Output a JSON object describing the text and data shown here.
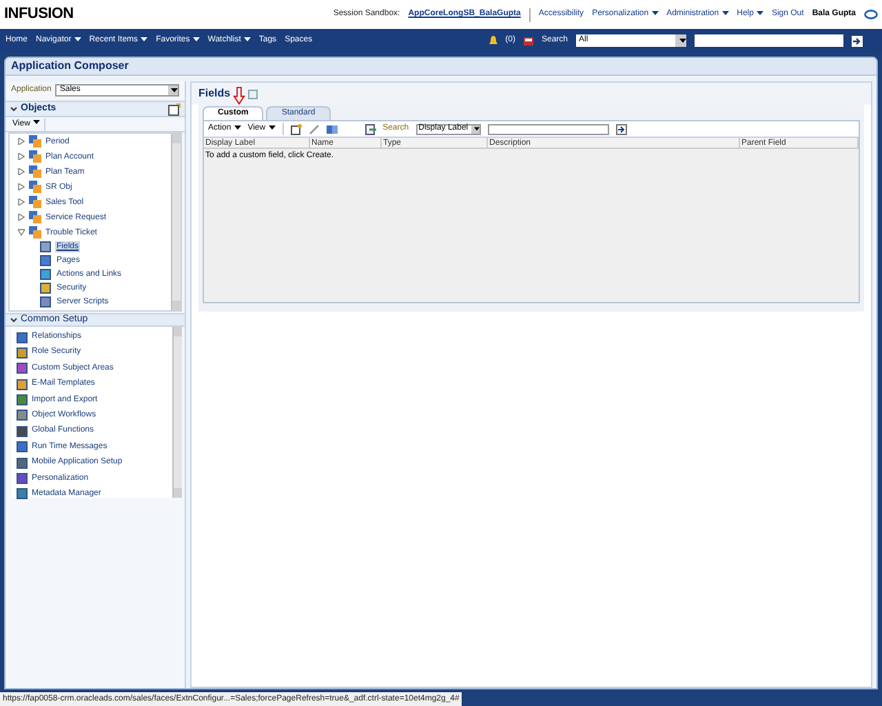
{
  "header": {
    "logo": "INFUSION",
    "session_label": "Session Sandbox:",
    "session_link": "AppCoreLongSB_BalaGupta",
    "links": [
      {
        "label": "Accessibility",
        "dropdown": false
      },
      {
        "label": "Personalization",
        "dropdown": true
      },
      {
        "label": "Administration",
        "dropdown": true
      },
      {
        "label": "Help",
        "dropdown": true
      },
      {
        "label": "Sign Out",
        "dropdown": false
      }
    ],
    "user": "Bala Gupta"
  },
  "nav": {
    "items": [
      {
        "label": "Home",
        "dropdown": false
      },
      {
        "label": "Navigator",
        "dropdown": true
      },
      {
        "label": "Recent Items",
        "dropdown": true
      },
      {
        "label": "Favorites",
        "dropdown": true
      },
      {
        "label": "Watchlist",
        "dropdown": true
      },
      {
        "label": "Tags",
        "dropdown": false
      },
      {
        "label": "Spaces",
        "dropdown": false
      }
    ],
    "notifications": "(0)",
    "search_label": "Search",
    "search_scope": "All"
  },
  "page_title": "Application Composer",
  "sidebar": {
    "application_label": "Application",
    "application_value": "Sales",
    "objects": {
      "title": "Objects",
      "view_menu": "View",
      "items": [
        {
          "label": "Period",
          "expanded": false
        },
        {
          "label": "Plan Account",
          "expanded": false
        },
        {
          "label": "Plan Team",
          "expanded": false
        },
        {
          "label": "SR Obj",
          "expanded": false
        },
        {
          "label": "Sales Tool",
          "expanded": false
        },
        {
          "label": "Service Request",
          "expanded": false
        },
        {
          "label": "Trouble Ticket",
          "expanded": true,
          "children": [
            {
              "label": "Fields",
              "selected": true
            },
            {
              "label": "Pages",
              "selected": false
            },
            {
              "label": "Actions and Links",
              "selected": false
            },
            {
              "label": "Security",
              "selected": false
            },
            {
              "label": "Server Scripts",
              "selected": false
            }
          ]
        }
      ]
    },
    "common_setup": {
      "title": "Common Setup",
      "items": [
        "Relationships",
        "Role Security",
        "Custom Subject Areas",
        "E-Mail Templates",
        "Import and Export",
        "Object Workflows",
        "Global Functions",
        "Run Time Messages",
        "Mobile Application Setup",
        "Personalization",
        "Metadata Manager"
      ]
    }
  },
  "main": {
    "title": "Fields",
    "tabs": [
      {
        "label": "Custom",
        "selected": true
      },
      {
        "label": "Standard",
        "selected": false
      }
    ],
    "toolbar": {
      "action_menu": "Action",
      "view_menu": "View",
      "search_label": "Search",
      "search_field": "Display Label"
    },
    "columns": [
      "Display Label",
      "Name",
      "Type",
      "Description",
      "Parent Field"
    ],
    "empty_message": "To add a custom field, click Create."
  },
  "status_bar": "https://fap0058-crm.oracleads.com/sales/faces/ExtnConfigur...=Sales;forcePageRefresh=true&_adf.ctrl-state=10et4mg2g_4#"
}
